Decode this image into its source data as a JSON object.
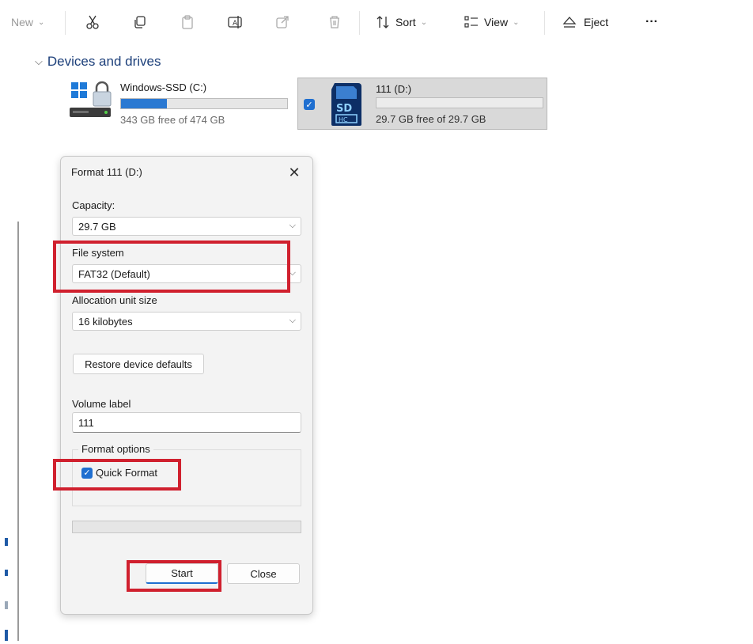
{
  "toolbar": {
    "new_label": "New",
    "sort_label": "Sort",
    "view_label": "View",
    "eject_label": "Eject",
    "more_label": "···",
    "icons": [
      "cut-icon",
      "copy-icon",
      "paste-icon",
      "rename-icon",
      "share-icon",
      "delete-icon",
      "sort-icon",
      "view-icon",
      "eject-icon"
    ]
  },
  "devices": {
    "header": "Devices and drives",
    "drives": [
      {
        "name": "Windows-SSD (C:)",
        "free_text": "343 GB free of 474 GB",
        "used_fraction": 0.276,
        "selected": false
      },
      {
        "name": "111 (D:)",
        "free_text": "29.7 GB free of 29.7 GB",
        "used_fraction": 0.0,
        "selected": true
      }
    ]
  },
  "dialog": {
    "title": "Format 111 (D:)",
    "close_glyph": "✕",
    "capacity_label": "Capacity:",
    "capacity_value": "29.7 GB",
    "filesystem_label": "File system",
    "filesystem_value": "FAT32 (Default)",
    "allocation_label": "Allocation unit size",
    "allocation_value": "16 kilobytes",
    "restore_button": "Restore device defaults",
    "volume_label_title": "Volume label",
    "volume_label_value": "111",
    "format_options_title": "Format options",
    "quick_format_label": "Quick Format",
    "quick_format_checked": true,
    "progress": 0,
    "start_button": "Start",
    "close_button": "Close"
  },
  "colors": {
    "accent": "#1f6fd0",
    "highlight": "#d0202e",
    "usage_fill": "#2b79d2"
  }
}
